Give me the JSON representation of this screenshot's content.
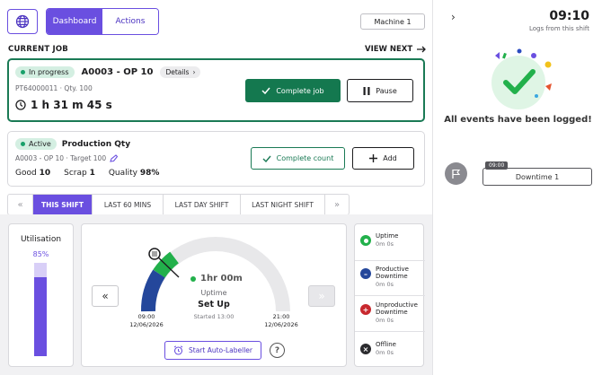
{
  "nav": {
    "globe_icon": "globe-icon",
    "tabs": [
      "Dashboard",
      "Actions"
    ],
    "machine": "Machine 1"
  },
  "current_job": {
    "heading": "CURRENT JOB",
    "view_next": "VIEW NEXT",
    "status": "In progress",
    "job_id": "A0003 - OP 10",
    "details_label": "Details",
    "part_info": "PT64000011 · Qty. 100",
    "duration": "1 h 31 m 45 s",
    "complete_label": "Complete job",
    "pause_label": "Pause"
  },
  "production": {
    "status": "Active",
    "title": "Production Qty",
    "sub_info": "A0003 - OP 10 · Target  100",
    "good_label": "Good",
    "good_value": "10",
    "scrap_label": "Scrap",
    "scrap_value": "1",
    "quality_label": "Quality",
    "quality_value": "98%",
    "complete_count_label": "Complete count",
    "add_label": "Add"
  },
  "period_tabs": [
    "THIS SHIFT",
    "LAST 60 MINS",
    "LAST DAY SHIFT",
    "LAST NIGHT SHIFT"
  ],
  "utilisation": {
    "label": "Utilisation",
    "value": "85%",
    "fraction": 0.85
  },
  "gauge": {
    "duration": "1hr 00m",
    "state": "Uptime",
    "activity": "Set Up",
    "started": "Started 13:00",
    "start_time": "09:00",
    "start_date": "12/06/2026",
    "end_time": "21:00",
    "end_date": "12/06/2026",
    "auto_label": "Start Auto-Labeller",
    "help": "?"
  },
  "legend": [
    {
      "label": "Uptime",
      "value": "0m 0s",
      "color": "#22b04b",
      "icon": "check"
    },
    {
      "label": "Productive Downtime",
      "value": "0m 0s",
      "color": "#24479b",
      "icon": "minus"
    },
    {
      "label": "Unproductive Downtime",
      "value": "0m 0s",
      "color": "#c8282e",
      "icon": "plus"
    },
    {
      "label": "Offline",
      "value": "0m 0s",
      "color": "#2b2b2e",
      "icon": "x"
    }
  ],
  "log": {
    "time": "09:10",
    "subtitle": "Logs from this shift",
    "all_logged": "All events have been logged!",
    "event_time": "09:00",
    "event_label": "Downtime 1"
  },
  "colors": {
    "brand": "#6a4fe0",
    "green_dark": "#14784f",
    "uptime": "#22b04b",
    "productive_down": "#24479b"
  }
}
